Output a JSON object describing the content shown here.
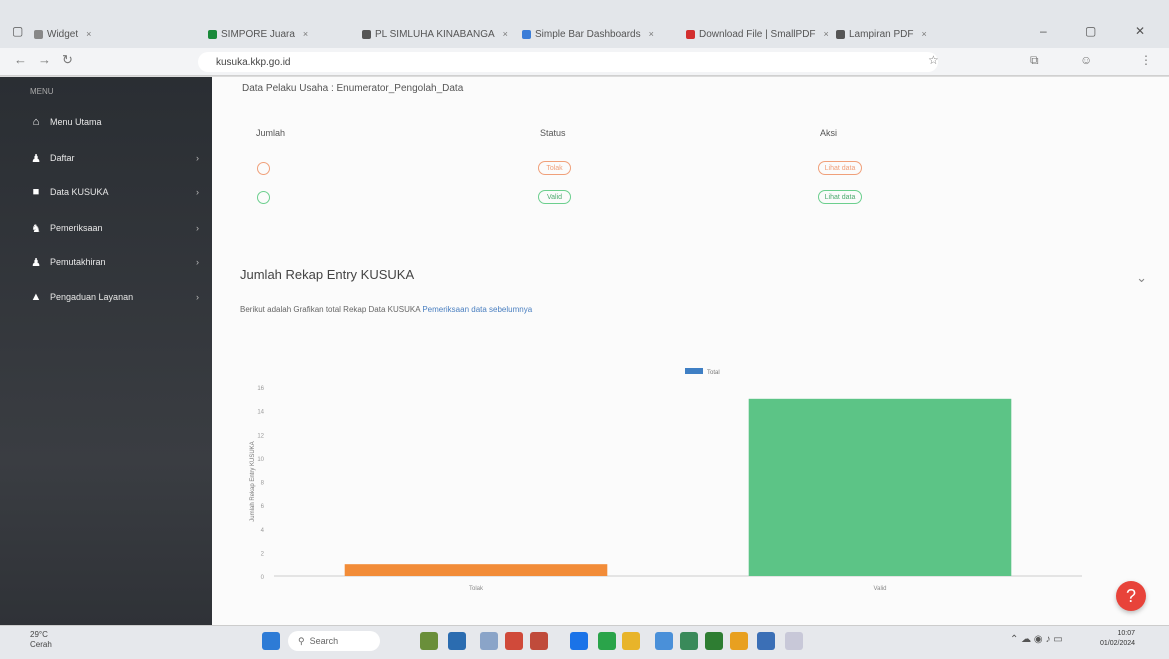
{
  "browser": {
    "tabs": [
      {
        "label": "Widget",
        "color": "#888"
      },
      {
        "label": "SIMPORE Juara",
        "color": "#1a8a3a"
      },
      {
        "label": "PL SIMLUHA KINABANGA",
        "color": "#555"
      },
      {
        "label": "Simple Bar Dashboards",
        "color": "#3b7dd8"
      },
      {
        "label": "Download File | SmallPDF",
        "color": "#d32f2f"
      },
      {
        "label": "Lampiran PDF",
        "color": "#555"
      }
    ],
    "url": "kusuka.kkp.go.id",
    "url_bold": "kkp.go.id"
  },
  "sidebar": {
    "header": "MENU",
    "items": [
      {
        "label": "Menu Utama",
        "icon": "home-icon",
        "glyph": "⌂",
        "chevron": false
      },
      {
        "label": "Daftar",
        "icon": "user-add-icon",
        "glyph": "♟",
        "chevron": true
      },
      {
        "label": "Data KUSUKA",
        "icon": "folder-icon",
        "glyph": "■",
        "chevron": true
      },
      {
        "label": "Pemeriksaan",
        "icon": "users-icon",
        "glyph": "♞",
        "chevron": true
      },
      {
        "label": "Pemutakhiran",
        "icon": "user-icon",
        "glyph": "♟",
        "chevron": true
      },
      {
        "label": "Pengaduan Layanan",
        "icon": "lock-icon",
        "glyph": "▲",
        "chevron": true
      }
    ]
  },
  "main": {
    "breadcrumb": "Data Pelaku Usaha : Enumerator_Pengolah_Data",
    "table": {
      "headers": [
        "Jumlah",
        "Status",
        "Aksi"
      ],
      "rows": [
        {
          "count": "1",
          "status": "Tolak",
          "action": "Lihat data",
          "color": "#f0a07a"
        },
        {
          "count": "15",
          "status": "Valid",
          "action": "Lihat data",
          "color": "#6ccf8e"
        }
      ]
    },
    "card": {
      "title": "Jumlah Rekap Entry KUSUKA",
      "subtitle": "Berikut adalah Grafikan total Rekap Data KUSUKA",
      "subtitle_link": "Pemeriksaan data sebelumnya"
    }
  },
  "chart_data": {
    "type": "bar",
    "categories": [
      "Tolak",
      "Valid"
    ],
    "series": [
      {
        "name": "Total",
        "values": [
          1,
          15
        ],
        "colors": [
          "#f28c38",
          "#5cc486"
        ]
      }
    ],
    "ylabel": "Jumlah Rekap Entry KUSUKA",
    "xlabel": "",
    "ylim": [
      0,
      16
    ],
    "yticks": [
      "0",
      "2",
      "4",
      "6",
      "8",
      "10",
      "12",
      "14",
      "16"
    ],
    "legend_position": "top-center",
    "grid": false
  },
  "taskbar": {
    "weather_temp": "29°C",
    "weather_desc": "Cerah",
    "search_placeholder": "Search",
    "time": "10:07",
    "date": "01/02/2024"
  }
}
